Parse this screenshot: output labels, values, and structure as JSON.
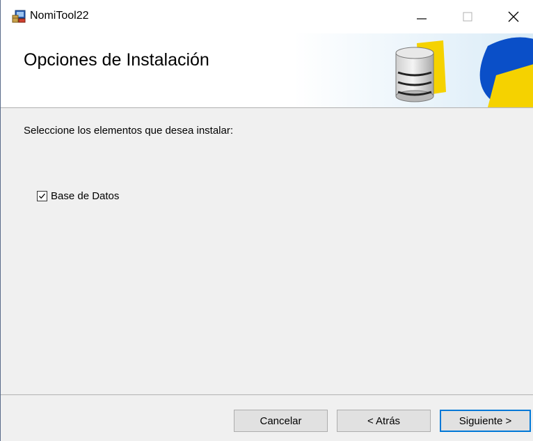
{
  "window": {
    "title": "NomiTool22",
    "controls": {
      "minimize_icon": "minimize-icon",
      "maximize_icon": "maximize-icon",
      "close_icon": "close-icon"
    }
  },
  "banner": {
    "title": "Opciones de Instalación",
    "art_icon": "database-icon",
    "colors": {
      "yellow": "#f5d200",
      "blue": "#0a4fc8"
    }
  },
  "content": {
    "instruction": "Seleccione los elementos que desea instalar:",
    "options": [
      {
        "label": "Base de Datos",
        "checked": true
      }
    ]
  },
  "buttons": {
    "cancel": "Cancelar",
    "back": "< Atrás",
    "next": "Siguiente >"
  },
  "colors": {
    "focus_border": "#0078d7",
    "button_face": "#e1e1e1",
    "dialog_bg": "#f0f0f0"
  }
}
